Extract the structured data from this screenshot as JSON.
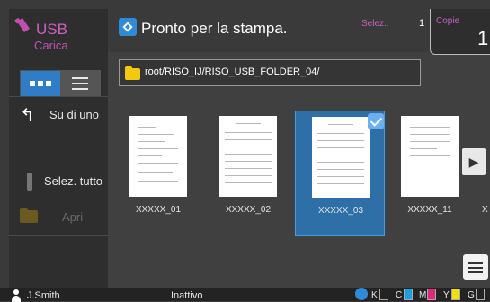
{
  "sidebar": {
    "title": "USB",
    "subtitle": "Carica",
    "view_modes": [
      "grid",
      "list"
    ],
    "up_label": "Su di uno",
    "select_all_label": "Selez. tutto",
    "open_label": "Apri"
  },
  "topbar": {
    "status": "Pronto per la stampa.",
    "selected_label": "Selez.:",
    "selected_count": "1",
    "copies_label": "Copie",
    "copies_value": "1"
  },
  "path": "root/RISO_IJ/RISO_USB_FOLDER_04/",
  "files": [
    {
      "name": "XXXXX_01",
      "selected": false
    },
    {
      "name": "XXXXX_02",
      "selected": false
    },
    {
      "name": "XXXXX_03",
      "selected": true
    },
    {
      "name": "XXXXX_11",
      "selected": false
    },
    {
      "name": "X",
      "selected": false
    }
  ],
  "footer": {
    "user": "J.Smith",
    "status": "Inattivo",
    "inks": [
      {
        "letter": "K",
        "color": "#ffffff"
      },
      {
        "letter": "C",
        "color": "#1aa0e0"
      },
      {
        "letter": "M",
        "color": "#e0287a"
      },
      {
        "letter": "Y",
        "color": "#f4e000"
      },
      {
        "letter": "G",
        "color": "#ffffff"
      }
    ]
  },
  "colors": {
    "accent": "#2e8bd8",
    "usb_title": "#d060c0",
    "selection": "#2e6fa8"
  },
  "icons": {
    "usb": "usb-icon",
    "up": "up-arrow-icon",
    "folder": "folder-icon",
    "next": "chevron-right-icon",
    "menu": "hamburger-menu-icon",
    "user": "user-icon"
  }
}
